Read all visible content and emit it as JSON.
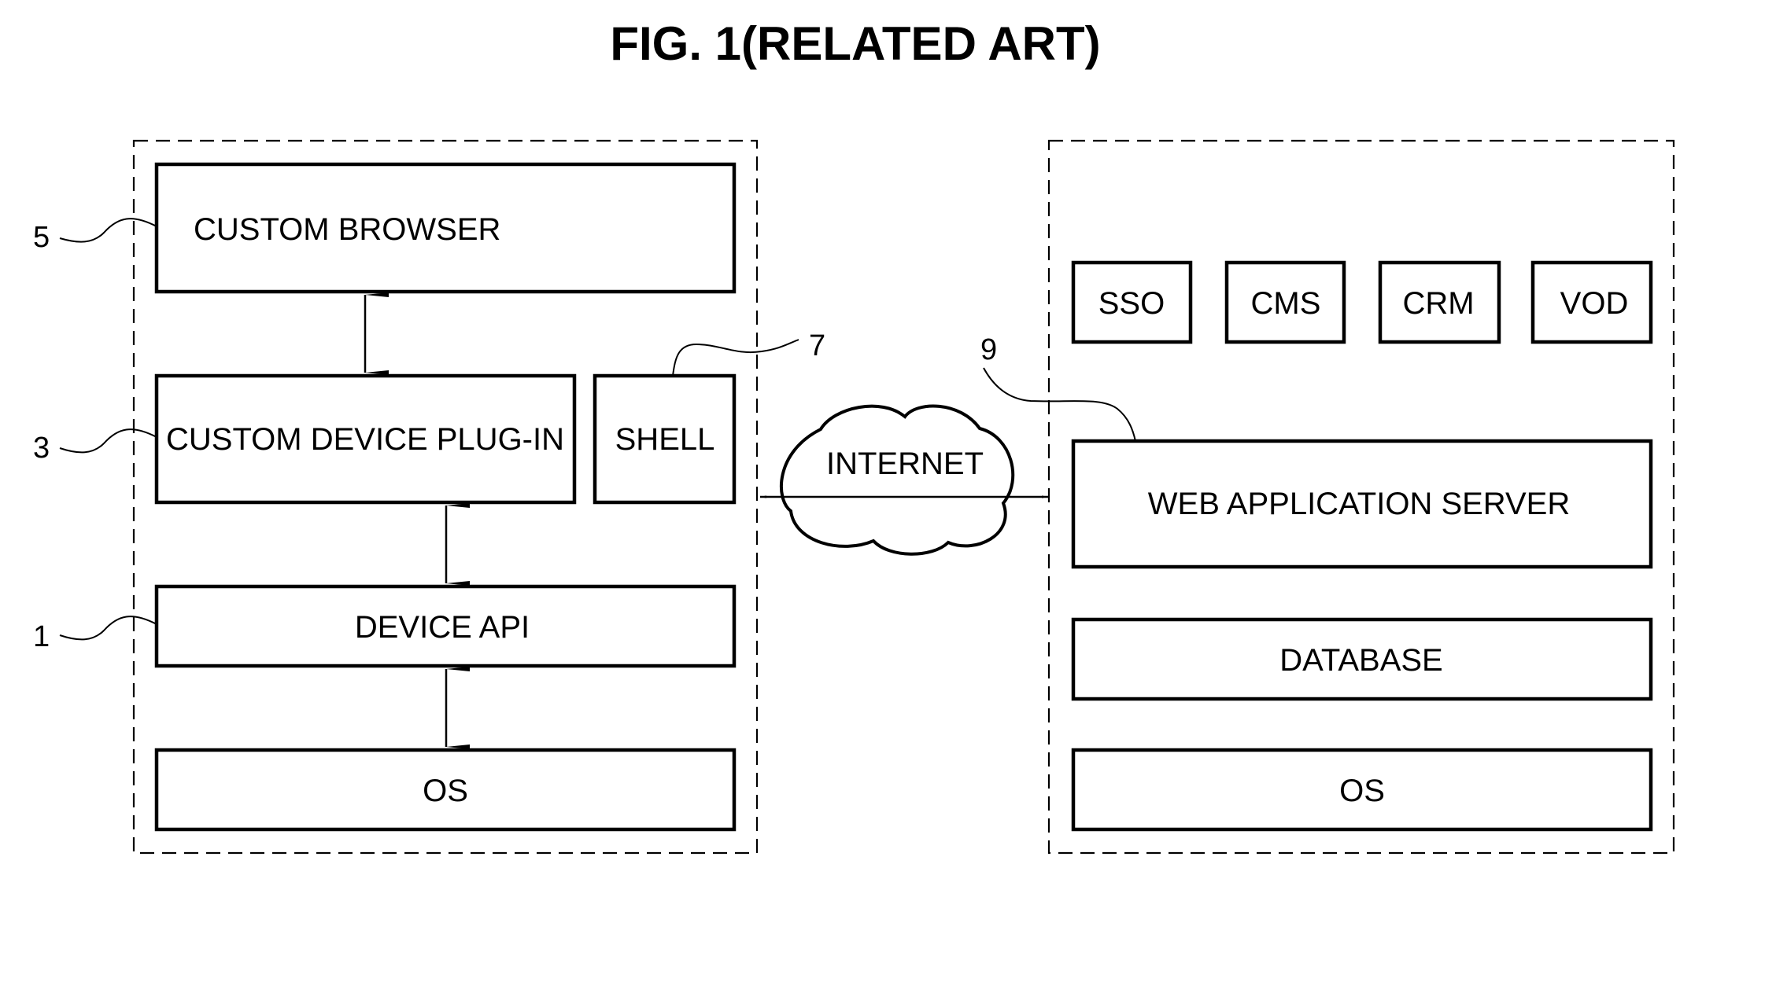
{
  "title": "FIG. 1(RELATED ART)",
  "client": {
    "blocks": {
      "custom_browser": "CUSTOM BROWSER",
      "custom_device_plugin": "CUSTOM DEVICE PLUG-IN",
      "shell": "SHELL",
      "device_api": "DEVICE API",
      "os": "OS"
    },
    "refs": {
      "custom_browser": "5",
      "custom_device_plugin": "3",
      "device_api": "1",
      "shell": "7"
    }
  },
  "network": {
    "label": "INTERNET"
  },
  "server": {
    "services": [
      "SSO",
      "CMS",
      "CRM",
      "VOD"
    ],
    "blocks": {
      "web_application_server": "WEB APPLICATION SERVER",
      "database": "DATABASE",
      "os": "OS"
    },
    "refs": {
      "web_application_server": "9"
    }
  }
}
